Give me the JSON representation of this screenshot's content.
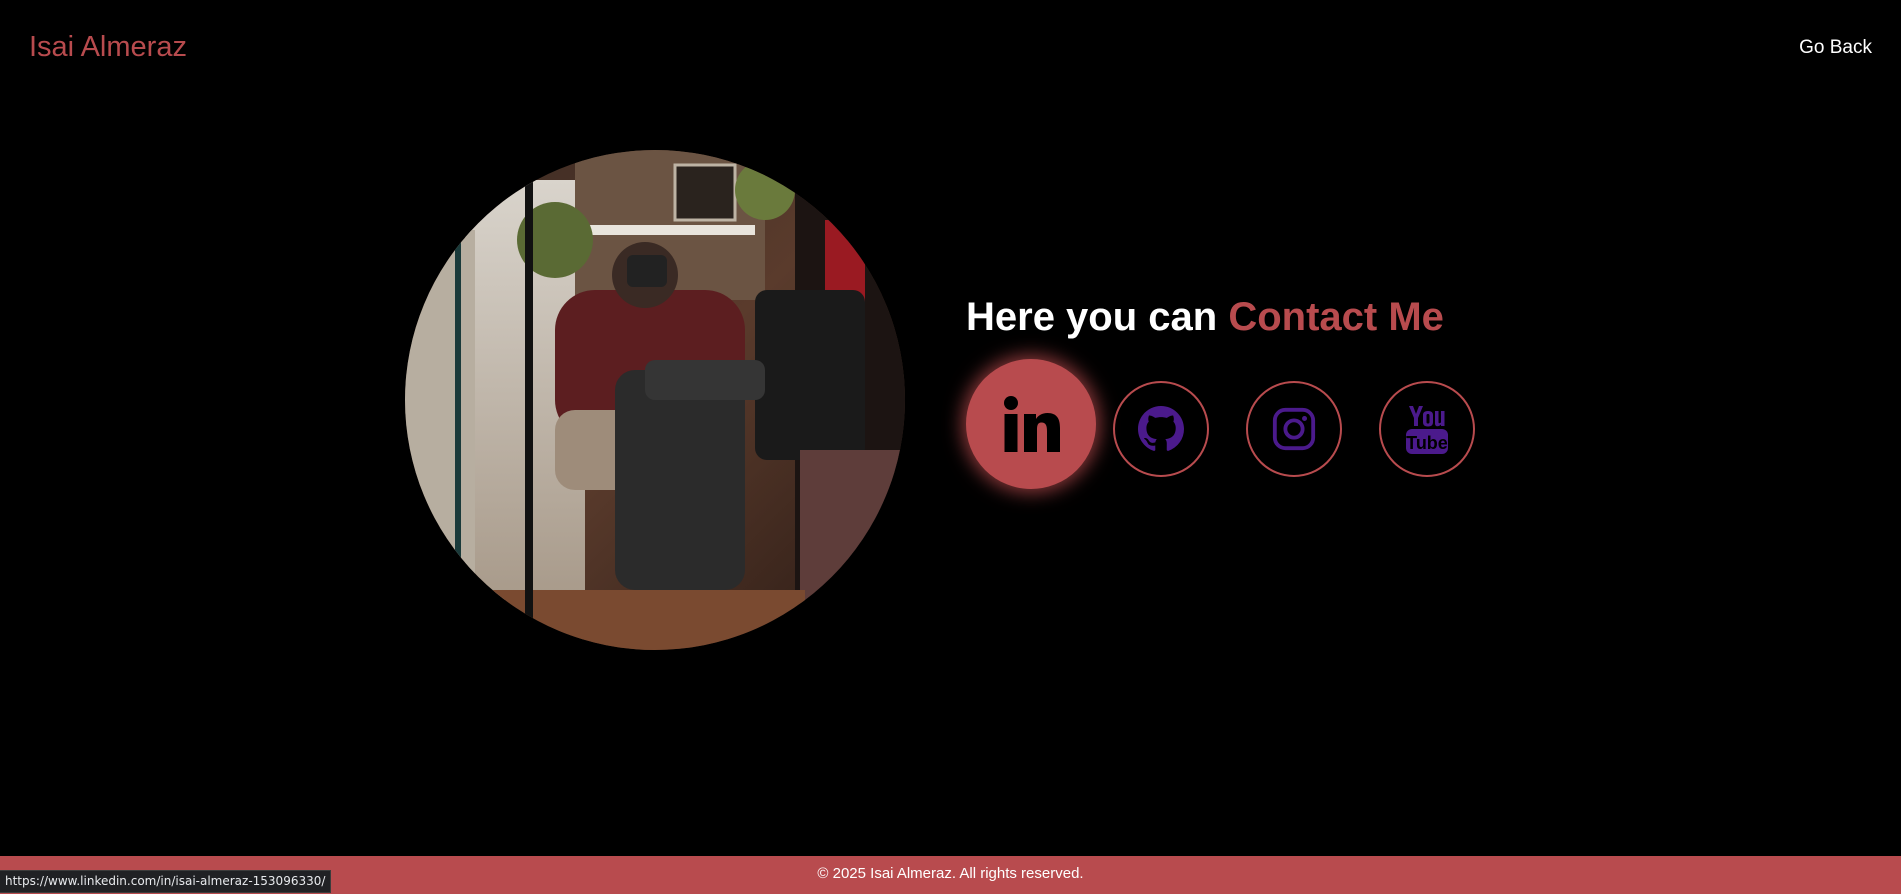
{
  "header": {
    "brand": "Isai Almeraz",
    "go_back_label": "Go Back"
  },
  "hero": {
    "heading_plain": "Here you can ",
    "heading_accent": "Contact Me",
    "portrait_alt": "Isai Almeraz portrait"
  },
  "social": [
    {
      "name": "LinkedIn",
      "icon": "linkedin-icon",
      "state": "hover"
    },
    {
      "name": "GitHub",
      "icon": "github-icon",
      "state": "default"
    },
    {
      "name": "Instagram",
      "icon": "instagram-icon",
      "state": "default"
    },
    {
      "name": "YouTube",
      "icon": "youtube-icon",
      "state": "default"
    }
  ],
  "footer": {
    "copyright": "© 2025 Isai Almeraz. All rights reserved."
  },
  "status_bar": {
    "url": "https://www.linkedin.com/in/isai-almeraz-153096330/"
  },
  "colors": {
    "background": "#000000",
    "accent": "#b84b4e",
    "icon_purple": "#4b1a8c",
    "text": "#ffffff"
  }
}
